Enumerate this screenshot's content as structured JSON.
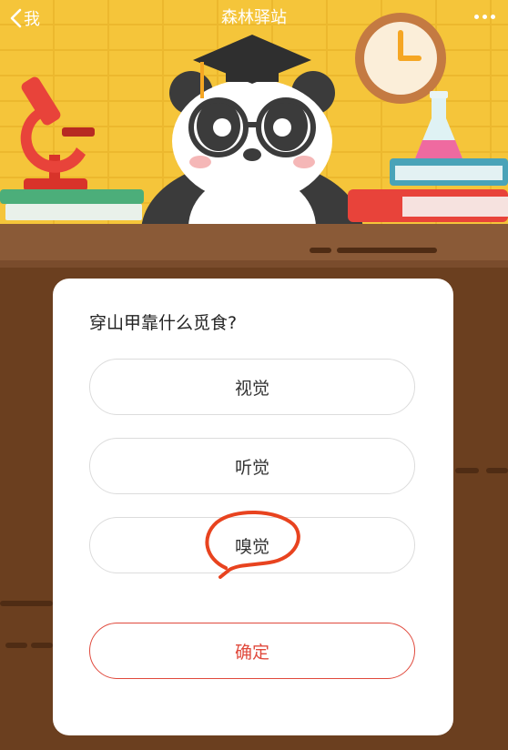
{
  "topbar": {
    "back_label": "我",
    "title": "森林驿站"
  },
  "quiz": {
    "question": "穿山甲靠什么觅食?",
    "options": [
      {
        "label": "视觉"
      },
      {
        "label": "听觉"
      },
      {
        "label": "嗅觉"
      }
    ],
    "confirm_label": "确定"
  },
  "colors": {
    "accent": "#e0493c",
    "scene_background": "#f5c53a",
    "desk": "#6b3f1f",
    "mark": "#e8431f"
  },
  "icons": [
    "back-arrow-icon",
    "more-dots-icon",
    "microscope-icon",
    "clock-icon",
    "flask-icon",
    "panda-mascot"
  ]
}
